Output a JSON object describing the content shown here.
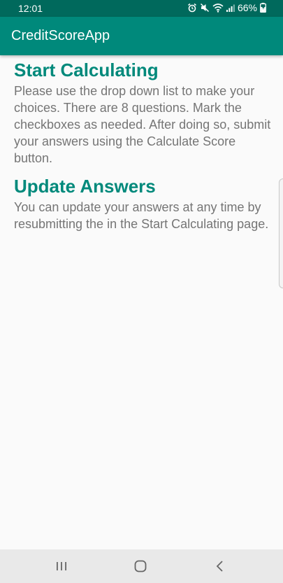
{
  "status_bar": {
    "time": "12:01",
    "battery": "66%",
    "icons": [
      "alarm-icon",
      "mute-icon",
      "wifi-icon",
      "signal-icon",
      "battery-charging-icon"
    ]
  },
  "app_bar": {
    "title": "CreditScoreApp",
    "color": "#00897b"
  },
  "sections": [
    {
      "title": "Start Calculating",
      "body": "Please use the drop down list to make your choices. There are 8 questions. Mark the checkboxes as needed. After doing so, submit your answers using the Calculate Score button."
    },
    {
      "title": "Update Answers",
      "body": "You can update your answers at any time by resubmitting the in the Start Calculating page."
    }
  ],
  "nav_bar": {
    "buttons": [
      "recents-icon",
      "home-icon",
      "back-icon"
    ]
  },
  "colors": {
    "status_bar": "#00695c",
    "accent": "#00897b",
    "body_text": "#757575",
    "background": "#fafafa"
  }
}
